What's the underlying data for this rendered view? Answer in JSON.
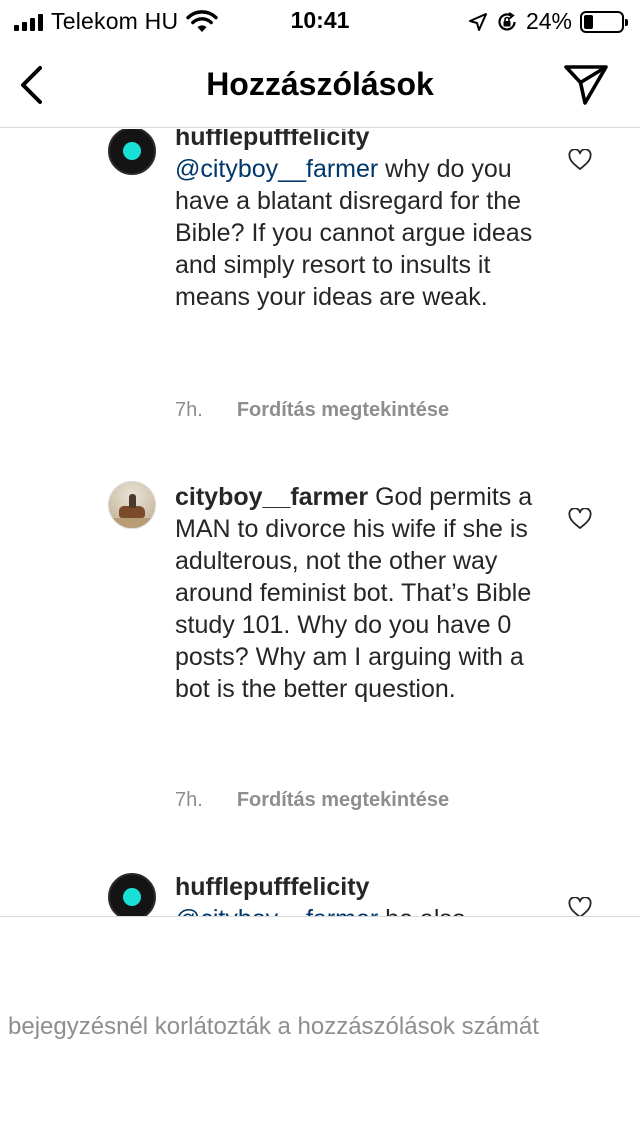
{
  "status_bar": {
    "carrier": "Telekom HU",
    "time": "10:41",
    "battery_percent": "24%",
    "battery_level": 0.24,
    "icons": [
      "signal-icon",
      "wifi-icon",
      "location-icon",
      "rotation-lock-icon",
      "battery-icon"
    ]
  },
  "nav": {
    "title": "Hozzászólások",
    "back_icon": "chevron-left-icon",
    "send_icon": "send-icon"
  },
  "comments": [
    {
      "username": "hufflepufffelicity",
      "mention": "@cityboy__farmer",
      "text": " why do you have a blatant disregard for the Bible? If you cannot argue ideas and simply resort to insults it means your ideas are weak.",
      "time": "7h.",
      "translate": "Fordítás megtekintése"
    },
    {
      "username": "cityboy__farmer",
      "text": " God permits a MAN to divorce his wife if she is adulterous, not the other way around feminist bot. That’s Bible study 101. Why do you have 0 posts? Why am I arguing with a bot is the better question.",
      "time": "7h.",
      "translate": "Fordítás megtekintése"
    },
    {
      "username": "hufflepufffelicity",
      "mention": "@cityboy__farmer",
      "text": " he also"
    }
  ],
  "footer": {
    "restricted_text": "bejegyzésnél korlátozták a hozzászólások számát"
  },
  "colors": {
    "text": "#262626",
    "mention": "#00376b",
    "secondary": "#8e8e8e",
    "divider": "#dbdbdb",
    "avatar_accent": "#19e0d6"
  }
}
